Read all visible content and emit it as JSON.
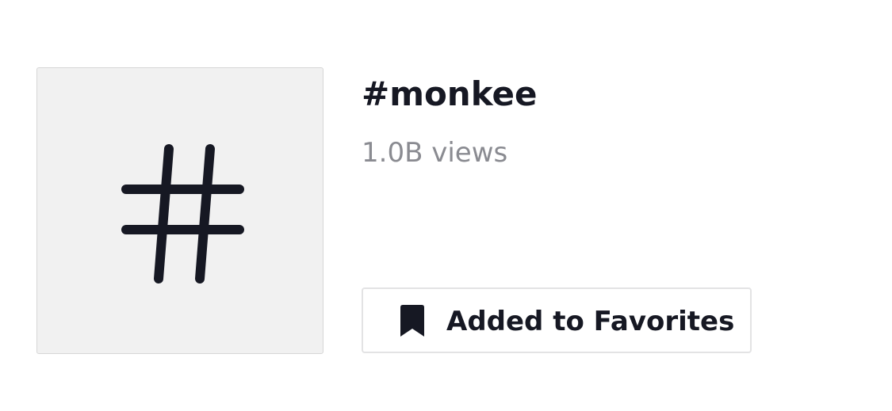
{
  "hashtag": {
    "thumbnail_icon": "hashtag-icon",
    "title": "#monkee",
    "views": "1.0B views"
  },
  "favorites_button": {
    "icon": "bookmark-icon",
    "label": "Added to Favorites"
  },
  "colors": {
    "text_primary": "#161823",
    "text_secondary": "#8a8b91",
    "thumbnail_bg": "#f1f1f1",
    "border": "#e3e3e4"
  }
}
